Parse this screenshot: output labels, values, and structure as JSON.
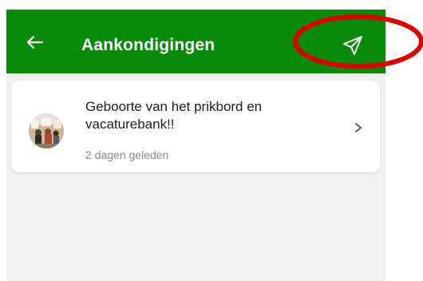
{
  "header": {
    "title": "Aankondigingen",
    "background_color": "#0a8a0a",
    "back_icon": "arrow-left-icon",
    "action_icon": "send-icon"
  },
  "announcements": [
    {
      "title": "Geboorte van het prikbord en vacaturebank!!",
      "time_ago": "2 dagen geleden",
      "thumbnail": "announcement-photo",
      "chevron_icon": "chevron-right-icon"
    }
  ],
  "annotation": {
    "shape": "ellipse",
    "color": "#e00000"
  },
  "colors": {
    "background": "#f0f0f0",
    "card": "#ffffff",
    "header_text": "#ffffff",
    "secondary_text": "#8a8a8a"
  }
}
